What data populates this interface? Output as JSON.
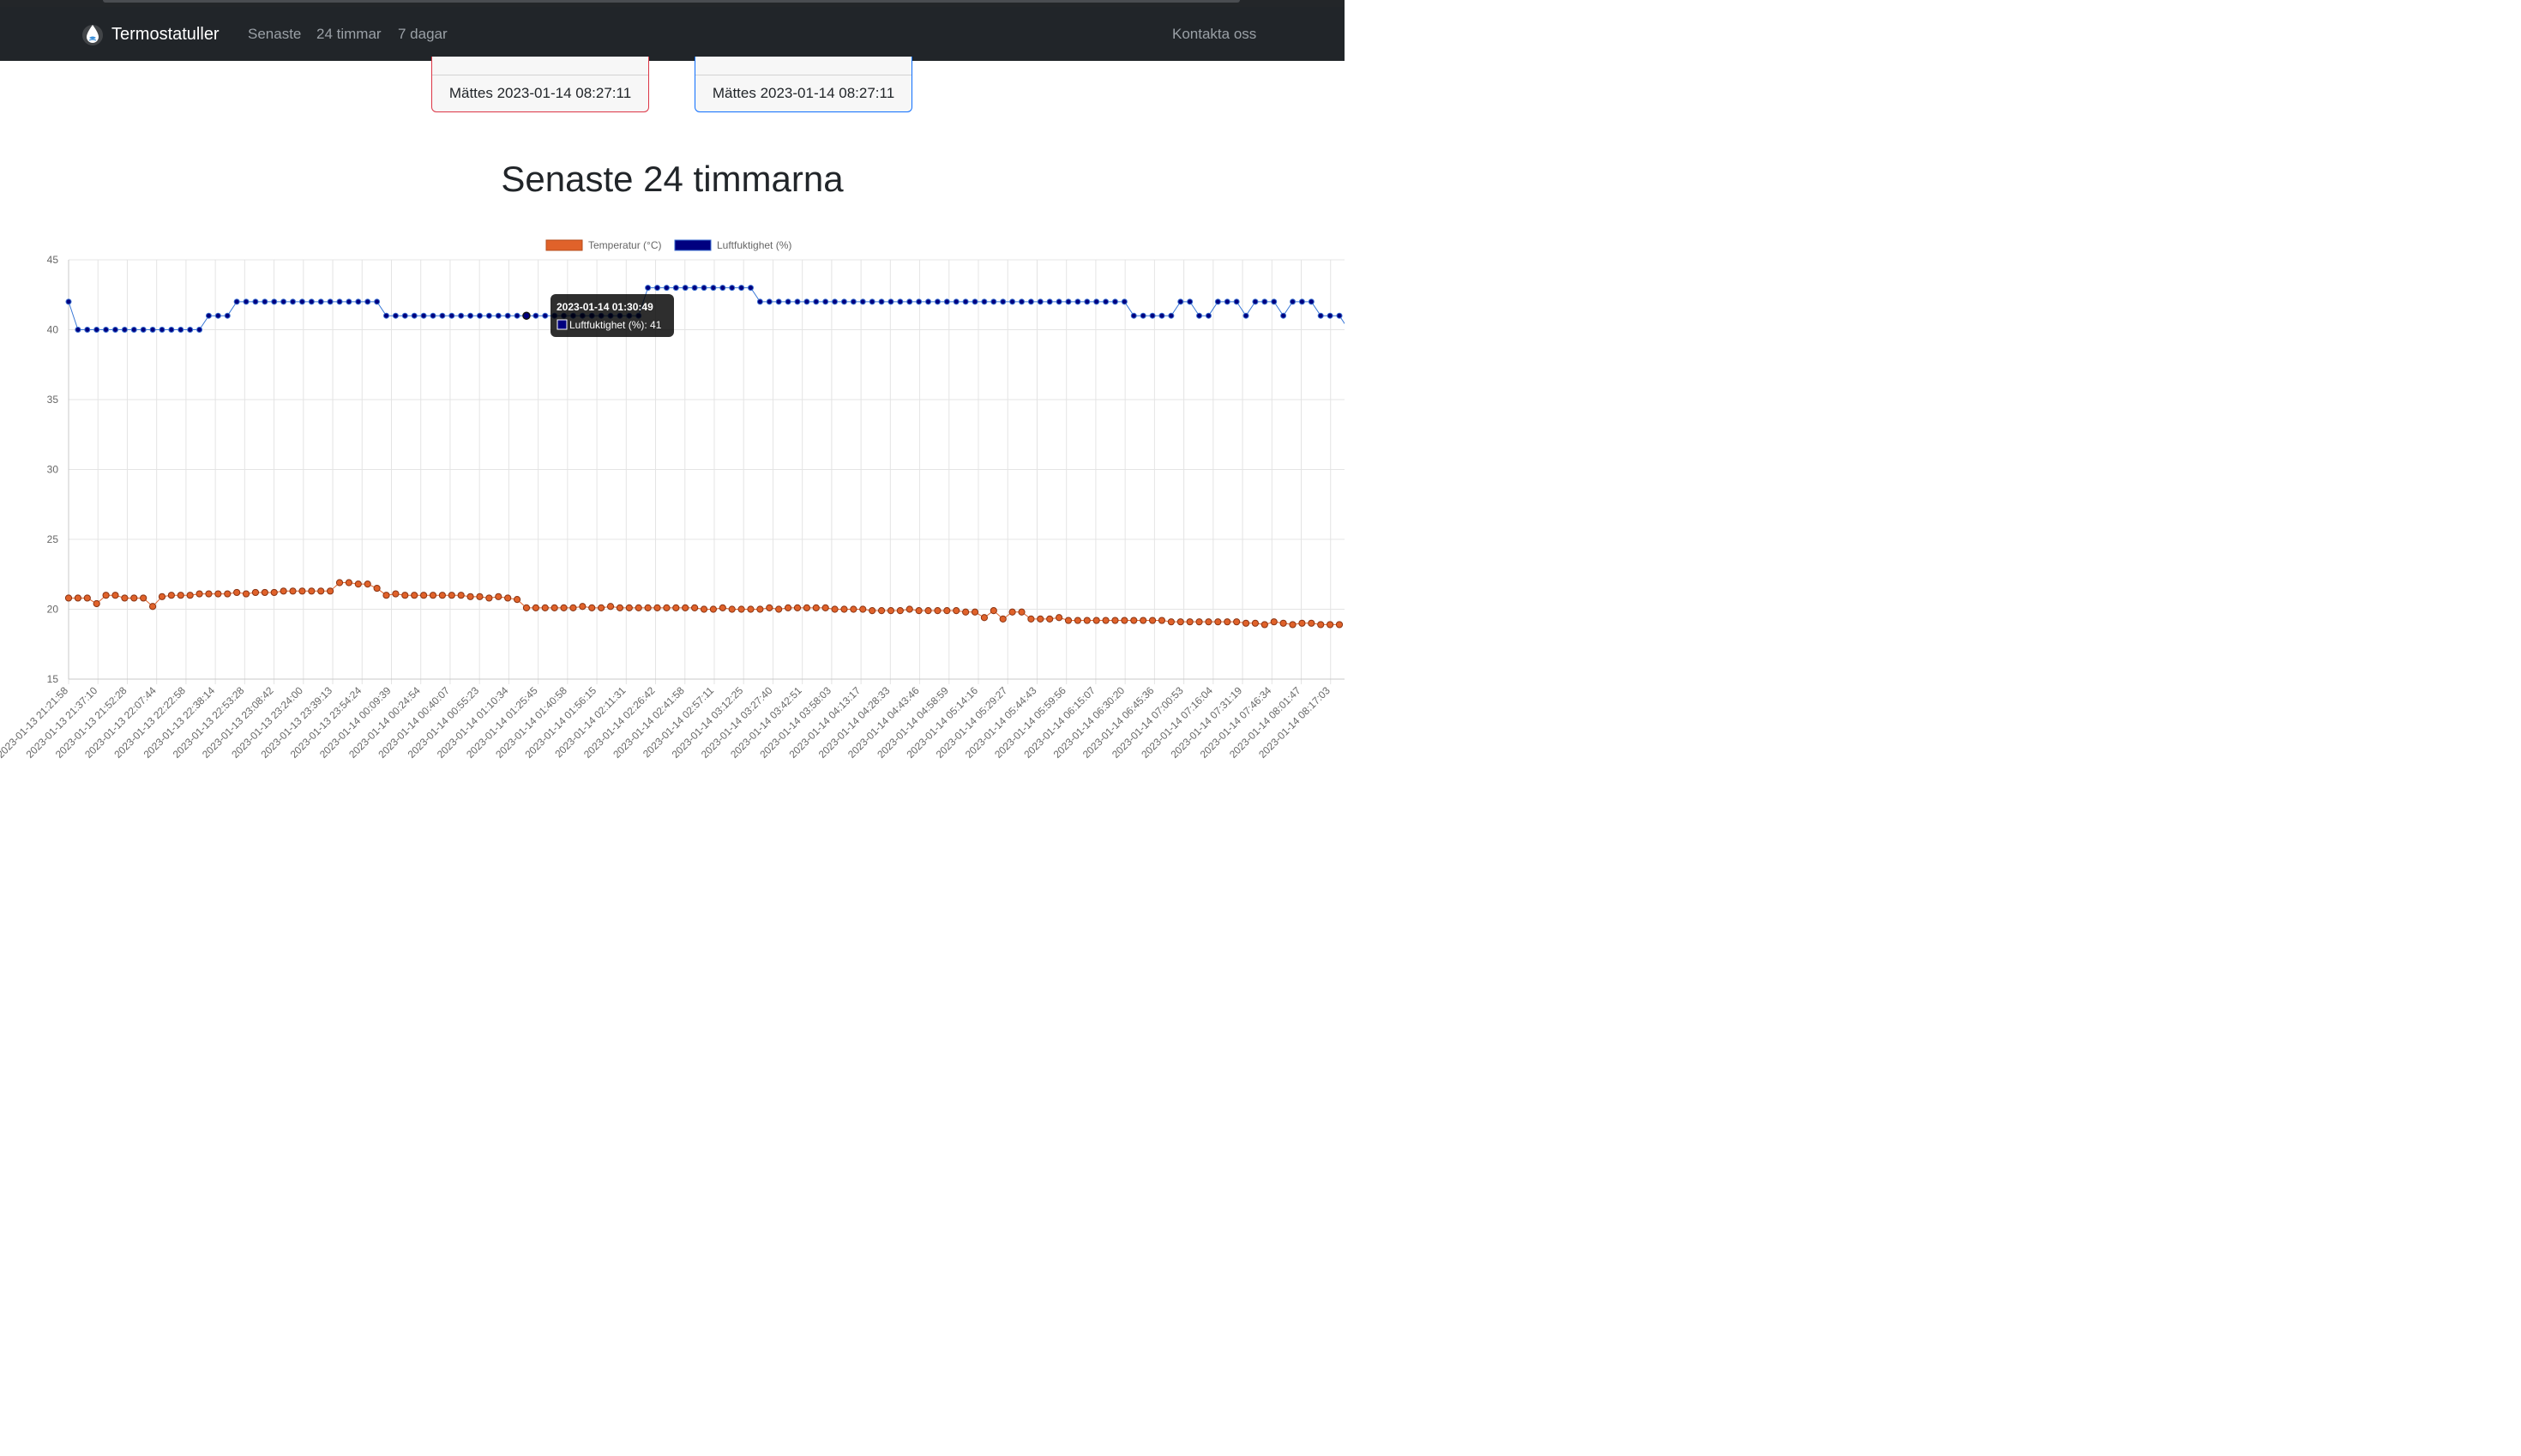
{
  "brand": {
    "name": "Termostatuller"
  },
  "nav": {
    "links": [
      "Senaste",
      "24 timmar",
      "7 dagar"
    ],
    "contact": "Kontakta oss"
  },
  "cards": {
    "temp_footer": "Mättes 2023-01-14 08:27:11",
    "humidity_footer": "Mättes 2023-01-14 08:27:11"
  },
  "page": {
    "title": "Senaste 24 timmarna"
  },
  "colors": {
    "temperature": "#e0622a",
    "humidity": "#00007f",
    "navbar": "#212529"
  },
  "chart_data": {
    "type": "line",
    "title": "",
    "xlabel": "",
    "ylabel": "",
    "ylim": [
      15,
      45
    ],
    "yticks": [
      15,
      20,
      25,
      30,
      35,
      40,
      45
    ],
    "grid": true,
    "legend_position": "top",
    "x_tick_labels": [
      "2023-01-13 21:21:58",
      "2023-01-13 21:37:10",
      "2023-01-13 21:52:28",
      "2023-01-13 22:07:44",
      "2023-01-13 22:22:58",
      "2023-01-13 22:38:14",
      "2023-01-13 22:53:28",
      "2023-01-13 23:08:42",
      "2023-01-13 23:24:00",
      "2023-01-13 23:39:13",
      "2023-01-13 23:54:24",
      "2023-01-14 00:09:39",
      "2023-01-14 00:24:54",
      "2023-01-14 00:40:07",
      "2023-01-14 00:55:23",
      "2023-01-14 01:10:34",
      "2023-01-14 01:25:45",
      "2023-01-14 01:40:58",
      "2023-01-14 01:56:15",
      "2023-01-14 02:11:31",
      "2023-01-14 02:26:42",
      "2023-01-14 02:41:58",
      "2023-01-14 02:57:11",
      "2023-01-14 03:12:25",
      "2023-01-14 03:27:40",
      "2023-01-14 03:42:51",
      "2023-01-14 03:58:03",
      "2023-01-14 04:13:17",
      "2023-01-14 04:28:33",
      "2023-01-14 04:43:46",
      "2023-01-14 04:58:59",
      "2023-01-14 05:14:16",
      "2023-01-14 05:29:27",
      "2023-01-14 05:44:43",
      "2023-01-14 05:59:56",
      "2023-01-14 06:15:07",
      "2023-01-14 06:30:20",
      "2023-01-14 06:45:36",
      "2023-01-14 07:00:53",
      "2023-01-14 07:16:04",
      "2023-01-14 07:31:19",
      "2023-01-14 07:46:34",
      "2023-01-14 08:01:47",
      "2023-01-14 08:17:03"
    ],
    "series": [
      {
        "name": "Temperatur (°C)",
        "values": [
          20.8,
          20.8,
          20.8,
          20.4,
          21.0,
          21.0,
          20.8,
          20.8,
          20.8,
          20.2,
          20.9,
          21.0,
          21.0,
          21.0,
          21.1,
          21.1,
          21.1,
          21.1,
          21.2,
          21.1,
          21.2,
          21.2,
          21.2,
          21.3,
          21.3,
          21.3,
          21.3,
          21.3,
          21.3,
          21.9,
          21.9,
          21.8,
          21.8,
          21.5,
          21.0,
          21.1,
          21.0,
          21.0,
          21.0,
          21.0,
          21.0,
          21.0,
          21.0,
          20.9,
          20.9,
          20.8,
          20.9,
          20.8,
          20.7,
          20.1,
          20.1,
          20.1,
          20.1,
          20.1,
          20.1,
          20.2,
          20.1,
          20.1,
          20.2,
          20.1,
          20.1,
          20.1,
          20.1,
          20.1,
          20.1,
          20.1,
          20.1,
          20.1,
          20.0,
          20.0,
          20.1,
          20.0,
          20.0,
          20.0,
          20.0,
          20.1,
          20.0,
          20.1,
          20.1,
          20.1,
          20.1,
          20.1,
          20.0,
          20.0,
          20.0,
          20.0,
          19.9,
          19.9,
          19.9,
          19.9,
          20.0,
          19.9,
          19.9,
          19.9,
          19.9,
          19.9,
          19.8,
          19.8,
          19.4,
          19.9,
          19.3,
          19.8,
          19.8,
          19.3,
          19.3,
          19.3,
          19.4,
          19.2,
          19.2,
          19.2,
          19.2,
          19.2,
          19.2,
          19.2,
          19.2,
          19.2,
          19.2,
          19.2,
          19.1,
          19.1,
          19.1,
          19.1,
          19.1,
          19.1,
          19.1,
          19.1,
          19.0,
          19.0,
          18.9,
          19.1,
          19.0,
          18.9,
          19.0,
          19.0,
          18.9,
          18.9,
          18.9
        ]
      },
      {
        "name": "Luftfuktighet (%)",
        "values": [
          42,
          40,
          40,
          40,
          40,
          40,
          40,
          40,
          40,
          40,
          40,
          40,
          40,
          40,
          40,
          41,
          41,
          41,
          42,
          42,
          42,
          42,
          42,
          42,
          42,
          42,
          42,
          42,
          42,
          42,
          42,
          42,
          42,
          42,
          41,
          41,
          41,
          41,
          41,
          41,
          41,
          41,
          41,
          41,
          41,
          41,
          41,
          41,
          41,
          41,
          41,
          41,
          41,
          41,
          41,
          41,
          41,
          41,
          41,
          41,
          41,
          41,
          43,
          43,
          43,
          43,
          43,
          43,
          43,
          43,
          43,
          43,
          43,
          43,
          42,
          42,
          42,
          42,
          42,
          42,
          42,
          42,
          42,
          42,
          42,
          42,
          42,
          42,
          42,
          42,
          42,
          42,
          42,
          42,
          42,
          42,
          42,
          42,
          42,
          42,
          42,
          42,
          42,
          42,
          42,
          42,
          42,
          42,
          42,
          42,
          42,
          42,
          42,
          42,
          41,
          41,
          41,
          41,
          41,
          42,
          42,
          41,
          41,
          42,
          42,
          42,
          41,
          42,
          42,
          42,
          41,
          42,
          42,
          42,
          41,
          41,
          41,
          40
        ]
      }
    ],
    "tooltip": {
      "title": "2023-01-14 01:30:49",
      "label": "Luftfuktighet (%): 41",
      "series": 1,
      "index": 49
    }
  }
}
